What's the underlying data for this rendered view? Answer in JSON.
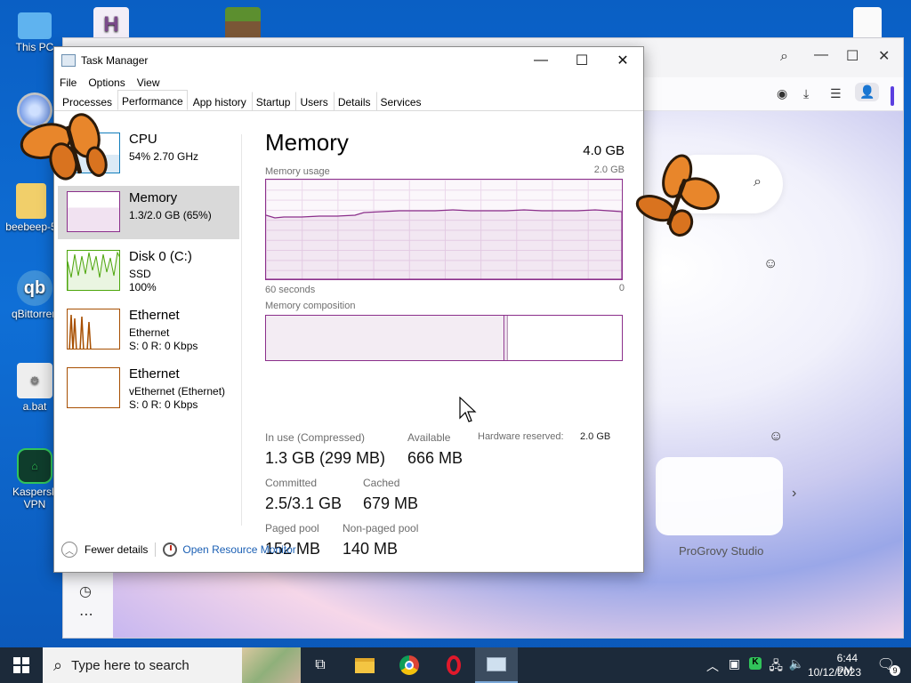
{
  "desktop": {
    "icons": [
      {
        "label": "This PC"
      },
      {
        "label": "beebeep-5"
      },
      {
        "label": "qBittorren"
      },
      {
        "label": "a.bat"
      },
      {
        "label": "Kaspersk VPN"
      }
    ]
  },
  "browser": {
    "tile_label": "ProGrovy Studio"
  },
  "task_manager": {
    "title": "Task Manager",
    "menu": [
      "File",
      "Options",
      "View"
    ],
    "tabs": [
      "Processes",
      "Performance",
      "App history",
      "Startup",
      "Users",
      "Details",
      "Services"
    ],
    "active_tab": "Performance",
    "perf_items": [
      {
        "name": "CPU",
        "line1": "54% 2.70 GHz",
        "line2": "",
        "color": "#117dbb"
      },
      {
        "name": "Memory",
        "line1": "1.3/2.0 GB (65%)",
        "line2": "",
        "color": "#8b2f8b"
      },
      {
        "name": "Disk 0 (C:)",
        "line1": "SSD",
        "line2": "100%",
        "color": "#4da60c"
      },
      {
        "name": "Ethernet",
        "line1": "Ethernet",
        "line2": "S: 0 R: 0 Kbps",
        "color": "#a74f01"
      },
      {
        "name": "Ethernet",
        "line1": "vEthernet (Ethernet)",
        "line2": "S: 0 R: 0 Kbps",
        "color": "#a74f01"
      }
    ],
    "memory": {
      "title": "Memory",
      "total": "4.0 GB",
      "usage_label": "Memory usage",
      "usage_max": "2.0 GB",
      "time_left": "60 seconds",
      "time_right": "0",
      "composition_label": "Memory composition",
      "in_use_label": "In use (Compressed)",
      "in_use_value": "1.3 GB (299 MB)",
      "available_label": "Available",
      "available_value": "666 MB",
      "hw_reserved_label": "Hardware reserved:",
      "hw_reserved_value": "2.0 GB",
      "committed_label": "Committed",
      "committed_value": "2.5/3.1 GB",
      "cached_label": "Cached",
      "cached_value": "679 MB",
      "paged_label": "Paged pool",
      "paged_value": "152 MB",
      "nonpaged_label": "Non-paged pool",
      "nonpaged_value": "140 MB"
    },
    "fewer_details": "Fewer details",
    "open_resource_monitor": "Open Resource Monitor"
  },
  "taskbar": {
    "search_placeholder": "Type here to search",
    "time": "6:44 PM",
    "date": "10/12/2023",
    "notification_count": "9"
  }
}
